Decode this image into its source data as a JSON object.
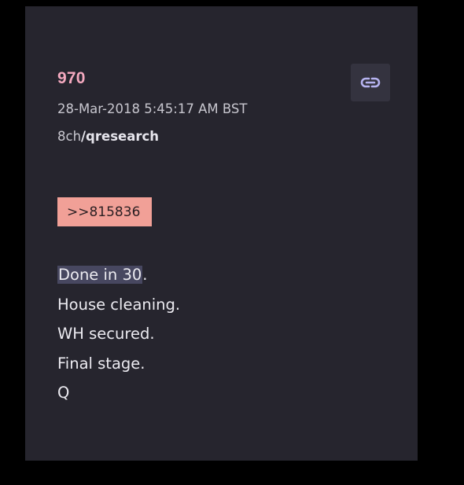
{
  "post": {
    "number": "970",
    "timestamp": "28-Mar-2018 5:45:17 AM BST",
    "board_prefix": "8ch",
    "board_name": "/qresearch",
    "reply_ref": ">>815836",
    "message_first_highlighted": "Done in 30",
    "message_first_rest": ".",
    "message_lines": [
      "House cleaning.",
      "WH secured.",
      "Final stage.",
      "Q"
    ]
  },
  "icons": {
    "link": "link-icon"
  },
  "colors": {
    "page_background": "#000000",
    "card_background": "#26252e",
    "post_number": "#f4a9bf",
    "reply_badge": "#f1a097",
    "link_button": "#34333f",
    "link_icon": "#b6b3f0",
    "text_highlight": "#474760"
  }
}
